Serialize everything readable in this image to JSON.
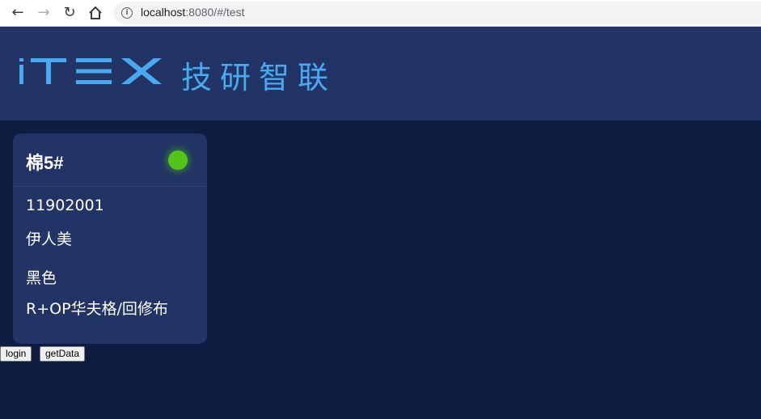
{
  "browser": {
    "url_host": "localhost",
    "url_rest": ":8080/#/test"
  },
  "header": {
    "logo_text": "iTEX",
    "brand_cn": "技研智联",
    "accent_color": "#4aa8f0"
  },
  "card": {
    "name": "棉5#",
    "status_color": "#52c41a",
    "order_no": "11902001",
    "customer": "伊人美",
    "color": "黑色",
    "fabric": "R+OP华夫格/回修布"
  },
  "buttons": {
    "login": "login",
    "get_data": "getData"
  }
}
